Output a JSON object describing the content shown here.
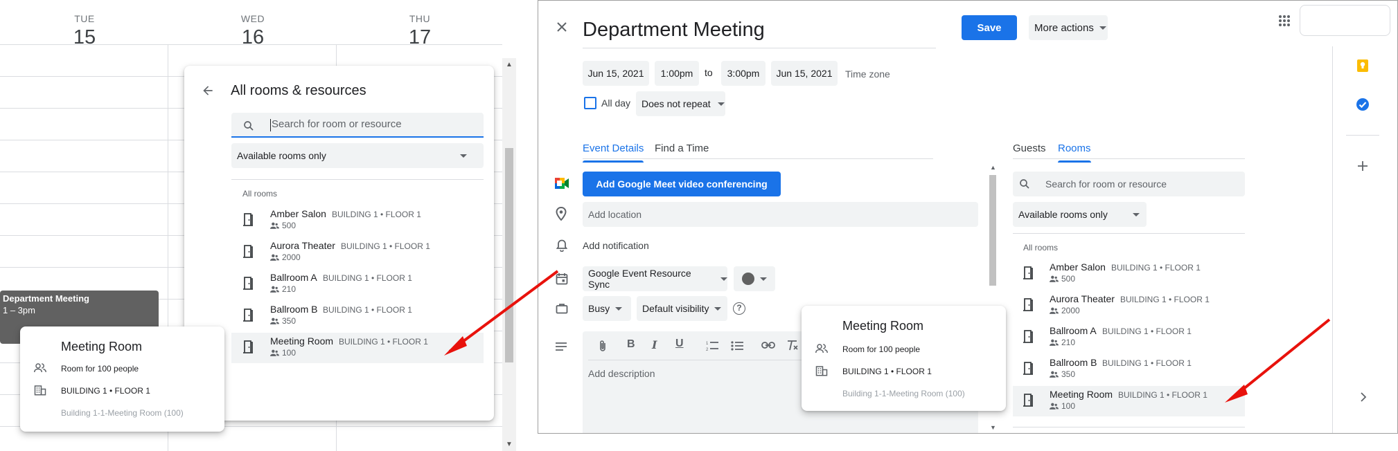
{
  "left_calendar": {
    "days": [
      {
        "name": "TUE",
        "num": "15"
      },
      {
        "name": "WED",
        "num": "16"
      },
      {
        "name": "THU",
        "num": "17"
      }
    ],
    "event": {
      "title": "Department Meeting",
      "time": "1 – 3pm"
    }
  },
  "rooms_panel": {
    "title": "All rooms & resources",
    "search_placeholder": "Search for room or resource",
    "filter": "Available rooms only",
    "list_label": "All rooms",
    "rooms": [
      {
        "name": "Amber Salon",
        "building": "BUILDING 1 • FLOOR 1",
        "capacity": "500"
      },
      {
        "name": "Aurora Theater",
        "building": "BUILDING 1 • FLOOR 1",
        "capacity": "2000"
      },
      {
        "name": "Ballroom A",
        "building": "BUILDING 1 • FLOOR 1",
        "capacity": "210"
      },
      {
        "name": "Ballroom B",
        "building": "BUILDING 1 • FLOOR 1",
        "capacity": "350"
      },
      {
        "name": "Meeting Room",
        "building": "BUILDING 1 • FLOOR 1",
        "capacity": "100"
      }
    ]
  },
  "room_tooltip": {
    "title": "Meeting Room",
    "capacity_text": "Room for 100 people",
    "building_text": "BUILDING 1 • FLOOR 1",
    "resource_name": "Building 1-1-Meeting Room (100)"
  },
  "event_editor": {
    "title": "Department Meeting",
    "save_label": "Save",
    "more_actions_label": "More actions",
    "start_date": "Jun 15, 2021",
    "start_time": "1:00pm",
    "to_label": "to",
    "end_time": "3:00pm",
    "end_date": "Jun 15, 2021",
    "time_zone_label": "Time zone",
    "all_day_label": "All day",
    "repeat_label": "Does not repeat",
    "tabs": {
      "details": "Event Details",
      "find_time": "Find a Time"
    },
    "meet_button": "Add Google Meet video conferencing",
    "location_placeholder": "Add location",
    "notification_label": "Add notification",
    "calendar_select": "Google Event Resource Sync",
    "busy_select": "Busy",
    "visibility_select": "Default visibility",
    "description_placeholder": "Add description",
    "side_tabs": {
      "guests": "Guests",
      "rooms": "Rooms"
    }
  },
  "colors": {
    "accent": "#1a73e8",
    "event_chip": "#616161",
    "arrow": "#e8120c"
  }
}
